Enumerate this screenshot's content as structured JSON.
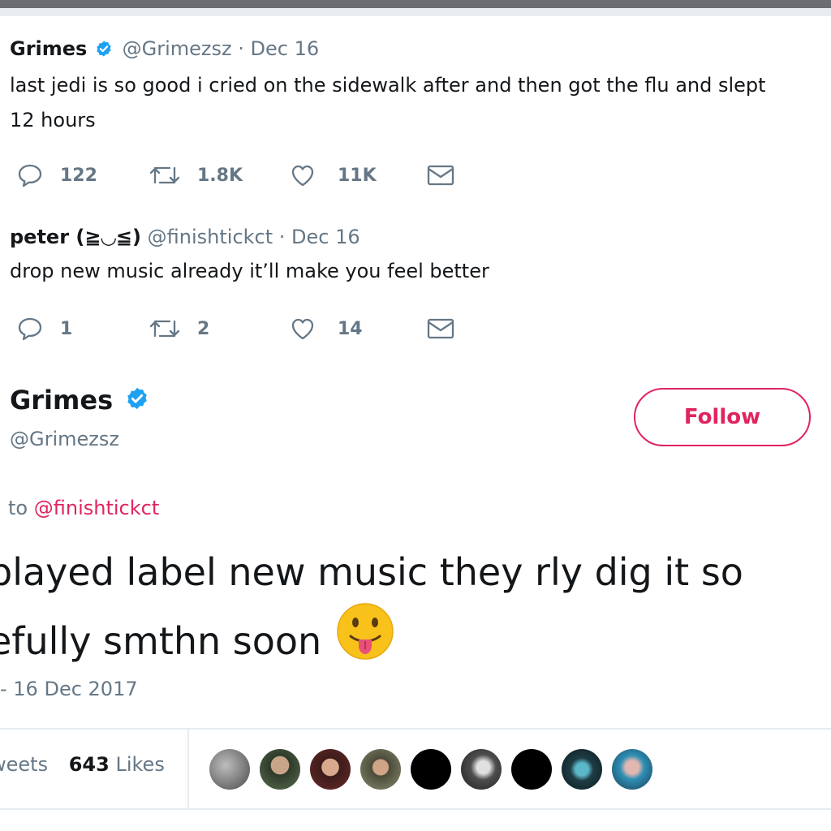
{
  "tweets": [
    {
      "name": "Grimes",
      "handle": "@Grimezsz",
      "date": "· Dec 16",
      "text_lines": [
        "last jedi is so good i cried on the sidewalk after and then got the flu and slept",
        "12 hours"
      ],
      "replies": "122",
      "retweets": "1.8K",
      "likes": "11K"
    },
    {
      "name": "peter (≧◡≦)",
      "handle": "@finishtickct",
      "date": "· Dec 16",
      "text_lines": [
        "drop new music already it’ll make you feel better"
      ],
      "replies": "1",
      "retweets": "2",
      "likes": "14"
    }
  ],
  "main": {
    "name": "Grimes",
    "handle": "@Grimezsz",
    "follow_label": "Follow",
    "reply_prefix": "to",
    "reply_mention": "@finishtickct",
    "text_line1": "played label new music they rly dig it so",
    "text_line2": "efully smthn soon",
    "timestamp": "- 16 Dec 2017",
    "retweets_label": "weets",
    "likes_count": "643",
    "likes_label": "Likes"
  },
  "icons": {
    "reply": "reply-icon",
    "retweet": "retweet-icon",
    "like": "heart-icon",
    "dm": "envelope-icon",
    "verified": "verified-badge-icon",
    "emoji": "tongue-out-emoji-icon"
  },
  "colors": {
    "accent": "#e0245e",
    "verified": "#1da1f2",
    "muted": "#657786",
    "text": "#14171a"
  }
}
